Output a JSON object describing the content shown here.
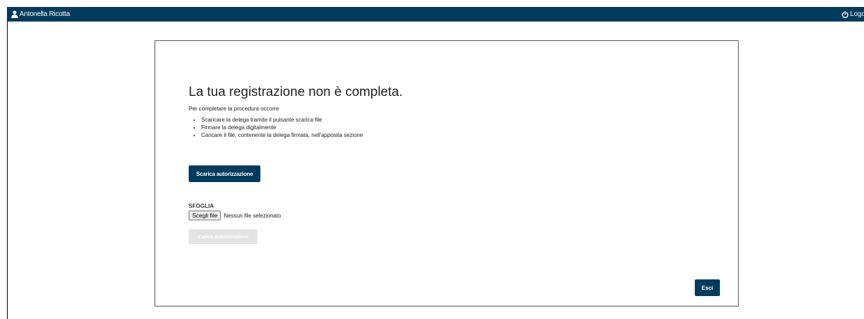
{
  "header": {
    "user_name": "Antonella Ricotta",
    "logout_label": "Logout",
    "background_color": "#003b5c",
    "user_icon": "user-icon",
    "logout_icon": "power-icon"
  },
  "main": {
    "title": "La tua registrazione non è completa.",
    "intro": "Per completare la procedura occorre",
    "steps": [
      "Scaricare la delega tramite il pulsante scarica file",
      "Firmare la delega digitalmente",
      "Caricare il file, contenente la delega firmata, nell'apposita sezione"
    ],
    "download_button": "Scarica autorizzazione",
    "browse_label": "SFOGLIA",
    "file_button": "Scegli file",
    "file_status": "Nessun file selezionato",
    "upload_button": "Carica autorizzazione",
    "exit_button": "Esci",
    "accent_color": "#003b5c",
    "disabled_color": "#e3e3e3"
  }
}
